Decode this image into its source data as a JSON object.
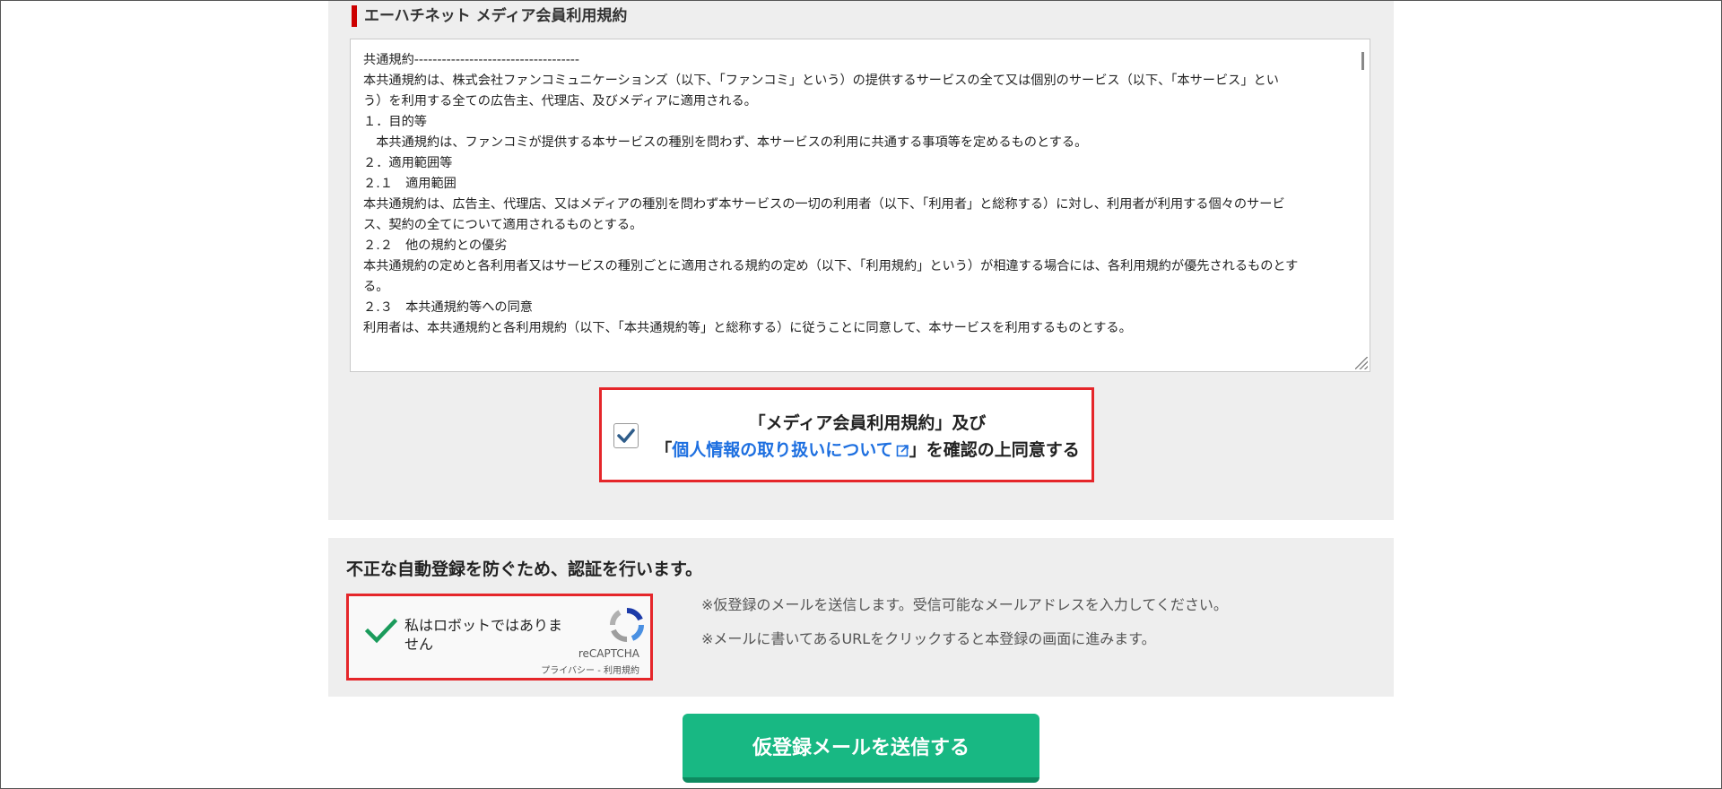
{
  "terms_section": {
    "title": "エーハチネット メディア会員利用規約",
    "lines": [
      "共通規約------------------------------------",
      "本共通規約は、株式会社ファンコミュニケーションズ（以下、「ファンコミ」という）の提供するサービスの全て又は個別のサービス（以下、「本サービス」とい",
      "う）を利用する全ての広告主、代理店、及びメディアに適用される。",
      "",
      "１．目的等",
      "　本共通規約は、ファンコミが提供する本サービスの種別を問わず、本サービスの利用に共通する事項等を定めるものとする。",
      "",
      "２．適用範囲等",
      "２.１　適用範囲",
      "本共通規約は、広告主、代理店、又はメディアの種別を問わず本サービスの一切の利用者（以下、「利用者」と総称する）に対し、利用者が利用する個々のサービ",
      "ス、契約の全てについて適用されるものとする。",
      "２.２　他の規約との優劣",
      "本共通規約の定めと各利用者又はサービスの種別ごとに適用される規約の定め（以下、「利用規約」という）が相違する場合には、各利用規約が優先されるものとす",
      "る。",
      "２.３　本共通規約等への同意",
      "利用者は、本共通規約と各利用規約（以下、「本共通規約等」と総称する）に従うことに同意して、本サービスを利用するものとする。"
    ]
  },
  "agreement": {
    "checked": true,
    "line1": "「メディア会員利用規約」及び",
    "prefix": "「",
    "link_text": "個人情報の取り扱いについて",
    "suffix": "」を確認の上同意する",
    "link_color": "#1d6fe0"
  },
  "captcha_section": {
    "heading": "不正な自動登録を防ぐため、認証を行います。",
    "recaptcha_label": "私はロボットではありません",
    "recaptcha_brand": "reCAPTCHA",
    "recaptcha_links": "プライバシー - 利用規約",
    "notes": [
      "※仮登録のメールを送信します。受信可能なメールアドレスを入力してください。",
      "※メールに書いてあるURLをクリックすると本登録の画面に進みます。"
    ]
  },
  "submit_button": {
    "label": "仮登録メールを送信する",
    "color": "#18b883"
  },
  "colors": {
    "accent_red": "#e5262a",
    "panel_bg": "#eeeeee",
    "check_green": "#1a9b5b"
  }
}
